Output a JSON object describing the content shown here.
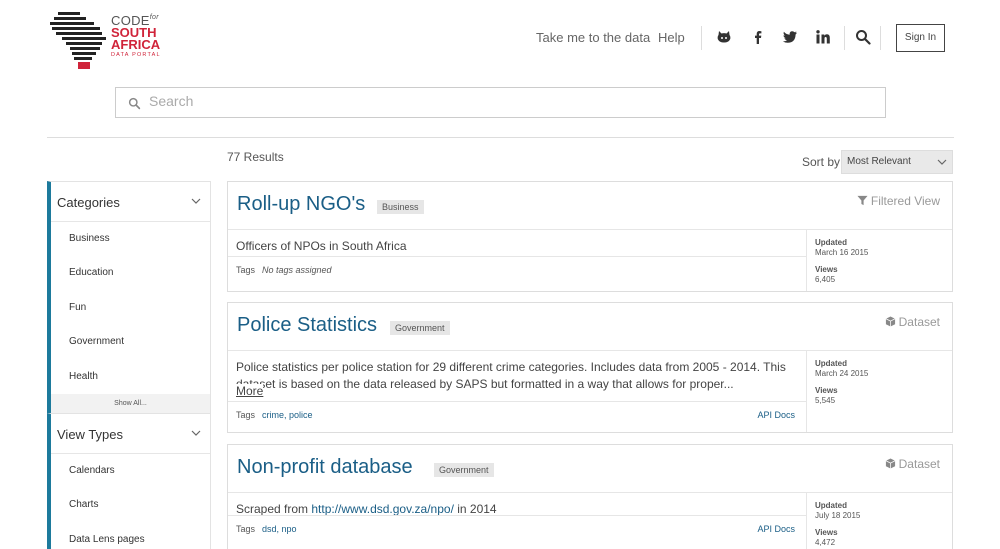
{
  "header": {
    "logo": {
      "line1": "CODE",
      "line1_small": "for",
      "line2": "SOUTH",
      "line3": "AFRICA",
      "line4": "DATA PORTAL"
    },
    "nav_links": [
      "Take me to the data",
      "Help"
    ],
    "nav_icons": [
      "github-icon",
      "facebook-icon",
      "twitter-icon",
      "linkedin-icon",
      "search-icon"
    ],
    "sign_in_label": "Sign In"
  },
  "search": {
    "placeholder": "Search"
  },
  "sidebar": {
    "categories": {
      "title": "Categories",
      "items": [
        "Business",
        "Education",
        "Fun",
        "Government",
        "Health"
      ],
      "show_all": "Show All..."
    },
    "view_types": {
      "title": "View Types",
      "items": [
        "Calendars",
        "Charts",
        "Data Lens pages"
      ]
    }
  },
  "results": {
    "count_label": "77 Results",
    "sort_label": "Sort by",
    "sort_selected": "Most Relevant",
    "items": [
      {
        "title": "Roll-up NGO's",
        "category": "Business",
        "type": "Filtered View",
        "type_icon": "filter-icon",
        "description": "Officers of NPOs in South Africa",
        "tags_label": "Tags",
        "tags": "No tags assigned",
        "updated_label": "Updated",
        "updated": "March 16 2015",
        "views_label": "Views",
        "views": "6,405"
      },
      {
        "title": "Police Statistics",
        "category": "Government",
        "type": "Dataset",
        "type_icon": "dataset-icon",
        "description": "Police statistics per police station for 29 different crime categories. Includes data from 2005 - 2014. This dataset is based on the data released by SAPS but formatted in a way that allows for proper...",
        "more": "More",
        "tags_label": "Tags",
        "tags": "crime, police",
        "api_docs": "API Docs",
        "updated_label": "Updated",
        "updated": "March 24 2015",
        "views_label": "Views",
        "views": "5,545"
      },
      {
        "title": "Non-profit database",
        "category": "Government",
        "type": "Dataset",
        "type_icon": "dataset-icon",
        "description_prefix": "Scraped from ",
        "description_link": "http://www.dsd.gov.za/npo/",
        "description_suffix": " in 2014",
        "tags_label": "Tags",
        "tags": "dsd, npo",
        "api_docs": "API Docs",
        "updated_label": "Updated",
        "updated": "July 18 2015",
        "views_label": "Views",
        "views": "4,472"
      }
    ]
  },
  "colors": {
    "accent": "#1d7a9c",
    "title_link": "#1a5e86",
    "brand_red": "#d0243a"
  }
}
